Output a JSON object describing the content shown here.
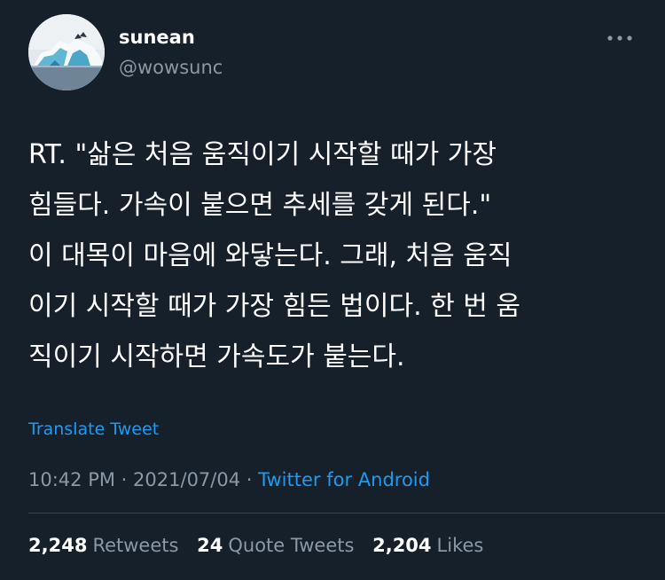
{
  "colors": {
    "background": "#15202b",
    "primary_text": "#ffffff",
    "secondary_text": "#8b98a5",
    "link": "#1d9bf0",
    "divider": "#38444d"
  },
  "author": {
    "display_name": "sunean",
    "handle": "@wowsunc",
    "avatar_icon": "iceberg-photo-avatar"
  },
  "more_icon": "more-dots-icon",
  "tweet": {
    "lines": [
      "RT. \"삶은 처음 움직이기 시작할 때가 가장",
      "힘들다. 가속이 붙으면 추세를 갖게 된다.\"",
      "이 대목이 마음에 와닿는다. 그래, 처음 움직",
      "이기 시작할 때가 가장 힘든 법이다. 한 번 움",
      "직이기 시작하면 가속도가 붙는다."
    ],
    "translate_label": "Translate Tweet",
    "time": "10:42 PM",
    "separator": "·",
    "date": "2021/07/04",
    "source": "Twitter for Android"
  },
  "stats": {
    "retweets_count": "2,248",
    "retweets_label": "Retweets",
    "quotes_count": "24",
    "quotes_label": "Quote Tweets",
    "likes_count": "2,204",
    "likes_label": "Likes"
  }
}
